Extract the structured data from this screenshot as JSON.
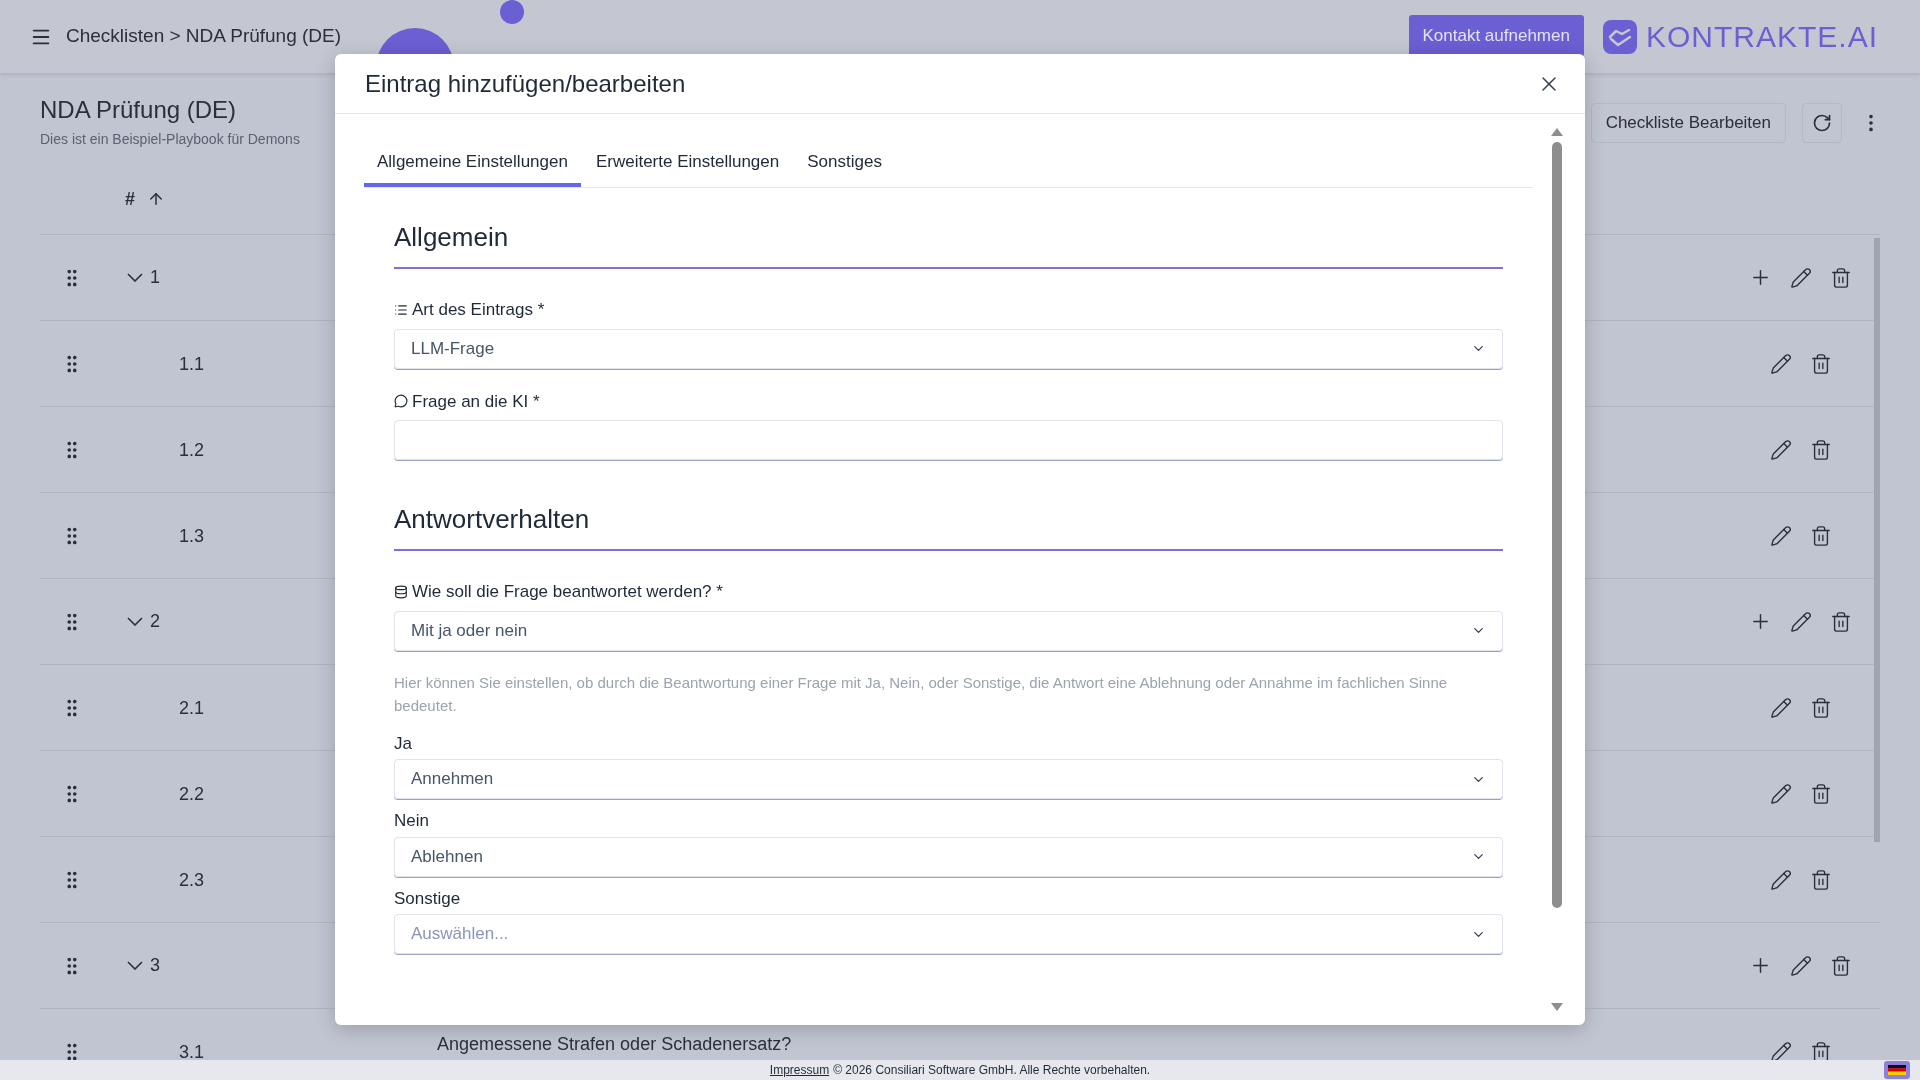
{
  "header": {
    "breadcrumb": "Checklisten > NDA Prüfung (DE)",
    "contact_button": "Kontakt aufnehmen",
    "logo": "KONTRAKTE.AI"
  },
  "page": {
    "title": "NDA Prüfung (DE)",
    "subtitle": "Dies ist ein Beispiel-Playbook für Demons",
    "edit_button": "Checkliste Bearbeiten"
  },
  "table": {
    "columns": [
      "#"
    ],
    "rows": [
      {
        "number": "1",
        "kind": "group",
        "expanded": true
      },
      {
        "number": "1.1",
        "kind": "item"
      },
      {
        "number": "1.2",
        "kind": "item"
      },
      {
        "number": "1.3",
        "kind": "item"
      },
      {
        "number": "2",
        "kind": "group",
        "expanded": true
      },
      {
        "number": "2.1",
        "kind": "item"
      },
      {
        "number": "2.2",
        "kind": "item"
      },
      {
        "number": "2.3",
        "kind": "item"
      },
      {
        "number": "3",
        "kind": "group",
        "expanded": true
      },
      {
        "number": "3.1",
        "kind": "item",
        "title": "Angemessene Strafen oder Schadenersatz?"
      }
    ]
  },
  "dialog": {
    "title": "Eintrag hinzufügen/bearbeiten",
    "tabs": [
      {
        "label": "Allgemeine Einstellungen",
        "selected": true
      },
      {
        "label": "Erweiterte Einstellungen",
        "selected": false
      },
      {
        "label": "Sonstiges",
        "selected": false
      }
    ],
    "sections": [
      {
        "heading": "Allgemein",
        "fields": [
          {
            "kind": "select",
            "label": "Art des Eintrags *",
            "value": "LLM-Frage"
          },
          {
            "kind": "text",
            "label": "Frage an die KI *"
          }
        ]
      },
      {
        "heading": "Antwortverhalten",
        "fields": [
          {
            "kind": "select",
            "label": "Wie soll die Frage beantwortet werden? *",
            "value": "Mit ja oder nein"
          },
          {
            "kind": "note",
            "text": "Hier können Sie einstellen, ob durch die Beantwortung einer Frage mit Ja, Nein, oder Sonstige, die Antwort eine Ablehnung oder Annahme im fachlichen Sinne bedeutet."
          },
          {
            "kind": "select",
            "label": "Ja",
            "value": "Annehmen"
          },
          {
            "kind": "select",
            "label": "Nein",
            "value": "Ablehnen"
          },
          {
            "kind": "select",
            "label": "Sonstige",
            "placeholder": "Auswählen..."
          }
        ]
      }
    ]
  },
  "footer": {
    "link": "Impressum",
    "text": "© 2026 Consiliari Software GmbH. Alle Rechte vorbehalten."
  }
}
